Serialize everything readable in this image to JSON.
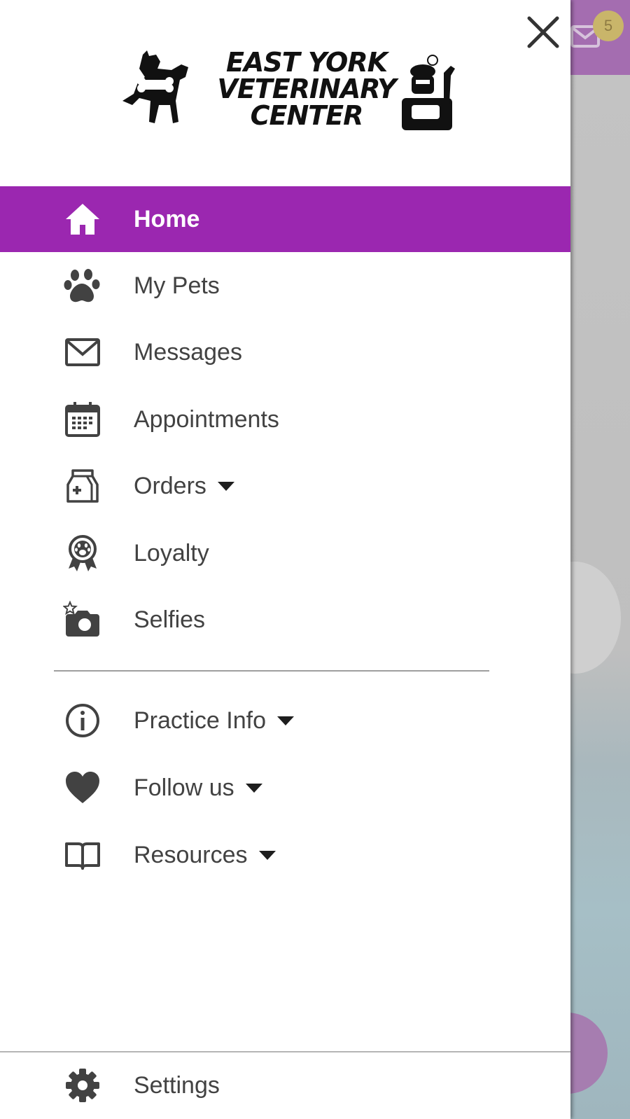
{
  "background": {
    "badge_count": "5"
  },
  "drawer": {
    "logo": {
      "line1": "EAST YORK",
      "line2": "VETERINARY",
      "line3": "CENTER"
    },
    "menu": [
      {
        "label": "Home",
        "icon": "home-icon",
        "active": true
      },
      {
        "label": "My Pets",
        "icon": "paw-icon"
      },
      {
        "label": "Messages",
        "icon": "envelope-icon"
      },
      {
        "label": "Appointments",
        "icon": "calendar-icon"
      },
      {
        "label": "Orders",
        "icon": "food-bag-icon",
        "expandable": true
      },
      {
        "label": "Loyalty",
        "icon": "award-ribbon-icon"
      },
      {
        "label": "Selfies",
        "icon": "camera-icon"
      }
    ],
    "secondary_menu": [
      {
        "label": "Practice Info",
        "icon": "info-icon",
        "expandable": true
      },
      {
        "label": "Follow us",
        "icon": "heart-icon",
        "expandable": true
      },
      {
        "label": "Resources",
        "icon": "book-icon",
        "expandable": true
      }
    ],
    "footer": {
      "label": "Settings",
      "icon": "gear-icon"
    }
  },
  "colors": {
    "accent": "#9b27b0",
    "icon": "#424242",
    "text": "#424242"
  }
}
